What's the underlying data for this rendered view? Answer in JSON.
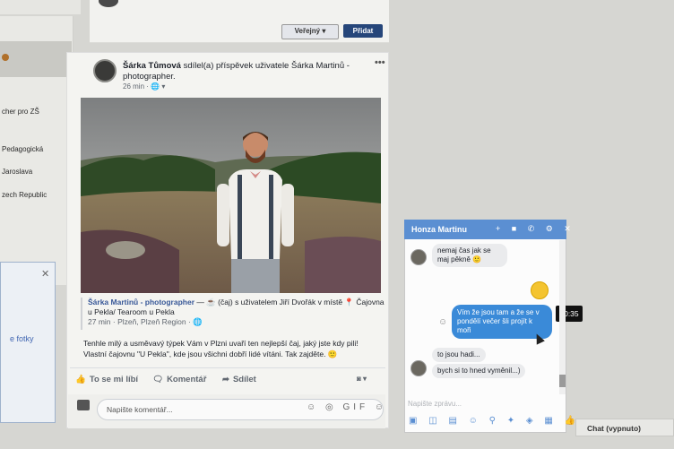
{
  "sidebar": {
    "items": [
      {
        "label": "cher pro ZŠ"
      },
      {
        "label": "Pedagogická"
      },
      {
        "label": "Jaroslava"
      },
      {
        "label": "zech Republic"
      }
    ],
    "ad_close": "✕",
    "ad_link": "e fotky"
  },
  "composer": {
    "privacy_label": "Veřejný ▾",
    "add_label": "Přidat"
  },
  "post": {
    "author": "Šárka Tůmová",
    "shared_text": "sdílel(a) příspěvek uživatele Šárka Martinů - photographer.",
    "time": "26 min",
    "privacy_icon": "globe-icon",
    "more": "•••",
    "shared": {
      "name": "Šárka Martinů - photographer",
      "line1": " — ☕ (čaj) s uživatelem Jiří Dvořák v místě 📍 Čajovna u Pekla/ Tearoom u Pekla",
      "meta": "27 min · Plzeň, Plzeň Region · 🌐"
    },
    "text": "Tenhle milý a usměvavý týpek Vám v Plzni uvaří ten nejlepší čaj, jaký jste kdy pili! Vlastní čajovnu \"U Pekla\", kde jsou všichni dobří lidé vítáni. Tak zajděte. 🙂",
    "actions": {
      "like": "To se mi líbí",
      "comment": "Komentář",
      "share": "Sdílet"
    },
    "comment_placeholder": "Napište komentář...",
    "comment_icons": "☺ ◎ GIF ☺"
  },
  "chat": {
    "title": "Honza Martinu",
    "header_icons": "+ ■ ✆ ⚙ ✕",
    "messages": [
      {
        "from": "in",
        "text": "nemaj čas jak se maj pěkně 🙂"
      },
      {
        "from": "out_emoji",
        "text": "😊"
      },
      {
        "from": "out",
        "text": "Vím že jsou tam a že se v pondělí večer šli projít k moři"
      },
      {
        "from": "in",
        "text": "to jsou hadi..."
      },
      {
        "from": "in",
        "text": "bych si to hned vyměnil...)"
      }
    ],
    "time_tooltip": "20:35",
    "input_placeholder": "Napište zprávu...",
    "tools": "▣ ◫ ▤ ☺ ⚲ ✦ ◈ ▦ 👍"
  },
  "chat_status": "Chat (vypnuto)",
  "colors": {
    "fb_blue": "#3a8ad8",
    "chat_header": "#5b8fd2",
    "add_button": "#26467a"
  }
}
